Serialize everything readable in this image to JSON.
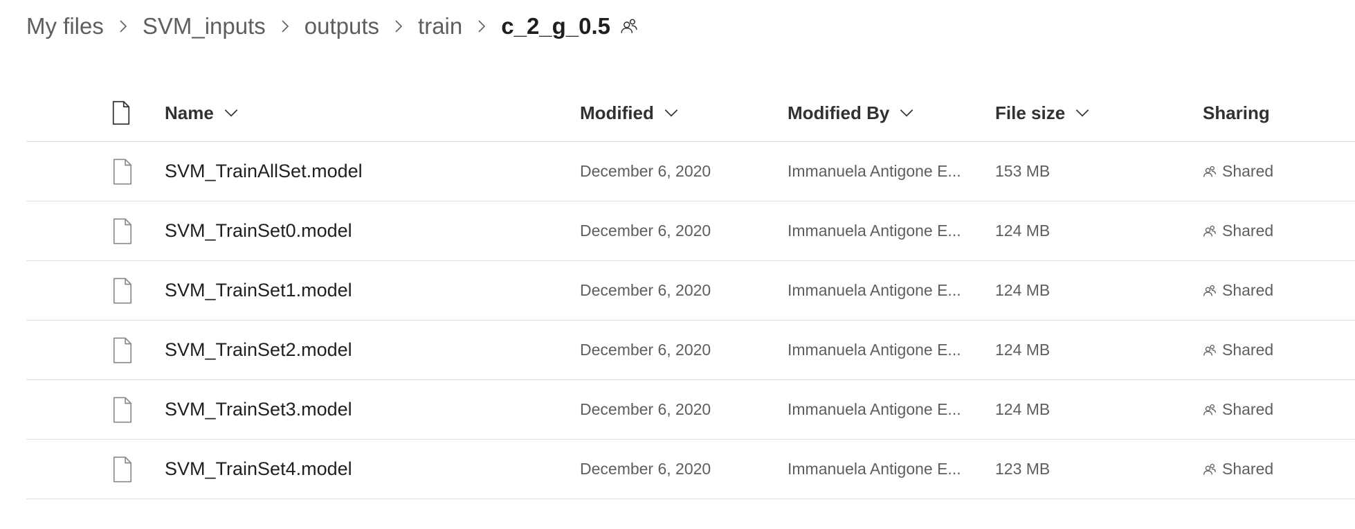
{
  "breadcrumb": {
    "items": [
      "My files",
      "SVM_inputs",
      "outputs",
      "train"
    ],
    "current": "c_2_g_0.5",
    "current_icon": "shared-people-icon"
  },
  "table": {
    "headers": {
      "type_icon": "file-icon",
      "name": "Name",
      "modified": "Modified",
      "modified_by": "Modified By",
      "file_size": "File size",
      "sharing": "Sharing"
    },
    "rows": [
      {
        "name": "SVM_TrainAllSet.model",
        "modified": "December 6, 2020",
        "modified_by": "Immanuela Antigone E...",
        "size": "153 MB",
        "sharing": "Shared"
      },
      {
        "name": "SVM_TrainSet0.model",
        "modified": "December 6, 2020",
        "modified_by": "Immanuela Antigone E...",
        "size": "124 MB",
        "sharing": "Shared"
      },
      {
        "name": "SVM_TrainSet1.model",
        "modified": "December 6, 2020",
        "modified_by": "Immanuela Antigone E...",
        "size": "124 MB",
        "sharing": "Shared"
      },
      {
        "name": "SVM_TrainSet2.model",
        "modified": "December 6, 2020",
        "modified_by": "Immanuela Antigone E...",
        "size": "124 MB",
        "sharing": "Shared"
      },
      {
        "name": "SVM_TrainSet3.model",
        "modified": "December 6, 2020",
        "modified_by": "Immanuela Antigone E...",
        "size": "124 MB",
        "sharing": "Shared"
      },
      {
        "name": "SVM_TrainSet4.model",
        "modified": "December 6, 2020",
        "modified_by": "Immanuela Antigone E...",
        "size": "123 MB",
        "sharing": "Shared"
      }
    ]
  },
  "colors": {
    "text_primary": "#201f1e",
    "text_secondary": "#605e5c",
    "divider": "#e1dfdd"
  }
}
